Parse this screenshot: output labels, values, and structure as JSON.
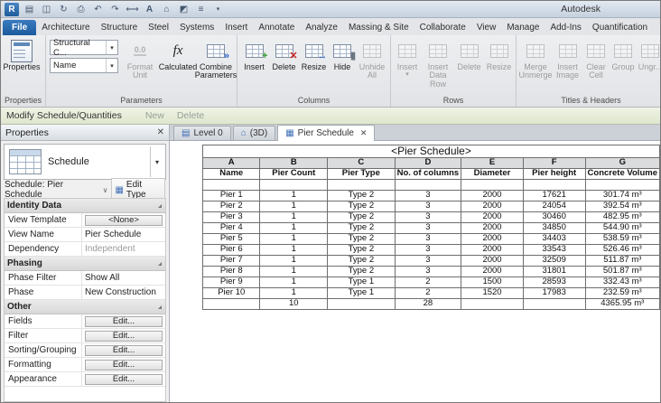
{
  "titlebar": {
    "brand": "Autodesk"
  },
  "ribbon_tabs": {
    "file": "File",
    "items": [
      "Architecture",
      "Structure",
      "Steel",
      "Systems",
      "Insert",
      "Annotate",
      "Analyze",
      "Massing & Site",
      "Collaborate",
      "View",
      "Manage",
      "Add-Ins",
      "Quantification"
    ]
  },
  "ribbon": {
    "properties": {
      "button": "Properties",
      "label": "Properties"
    },
    "parameters": {
      "field1": "Structural C...",
      "field2": "Name",
      "format_unit": "Format Unit",
      "calculated": "Calculated",
      "combine": "Combine Parameters",
      "label": "Parameters"
    },
    "columns": {
      "insert": "Insert",
      "delete": "Delete",
      "resize": "Resize",
      "hide": "Hide",
      "unhide": "Unhide All",
      "label": "Columns"
    },
    "rows": {
      "insert": "Insert",
      "insert_data_row": "Insert Data Row",
      "delete": "Delete",
      "resize": "Resize",
      "label": "Rows"
    },
    "titles": {
      "merge": "Merge Unmerge",
      "image": "Insert Image",
      "clear": "Clear Cell",
      "group": "Group",
      "ungroup": "Ungr...",
      "label": "Titles & Headers"
    }
  },
  "modify_bar": {
    "title": "Modify Schedule/Quantities",
    "new_label": "New",
    "delete_label": "Delete"
  },
  "properties_panel": {
    "header": "Properties",
    "type_selector": "Schedule",
    "instance_label": "Schedule: Pier Schedule",
    "edit_type": "Edit Type",
    "rows": [
      {
        "name": "Identity Data"
      },
      {
        "name": "View Template",
        "value": "<None>"
      },
      {
        "name": "View Name",
        "value": "Pier Schedule"
      },
      {
        "name": "Dependency",
        "value": "Independent"
      },
      {
        "name": "Phasing"
      },
      {
        "name": "Phase Filter",
        "value": "Show All"
      },
      {
        "name": "Phase",
        "value": "New Construction"
      },
      {
        "name": "Other"
      },
      {
        "name": "Fields",
        "value": "Edit..."
      },
      {
        "name": "Filter",
        "value": "Edit..."
      },
      {
        "name": "Sorting/Grouping",
        "value": "Edit..."
      },
      {
        "name": "Formatting",
        "value": "Edit..."
      },
      {
        "name": "Appearance",
        "value": "Edit..."
      }
    ]
  },
  "view_tabs": [
    {
      "label": "Level 0"
    },
    {
      "label": "(3D)"
    },
    {
      "label": "Pier Schedule",
      "close": "✕"
    }
  ],
  "schedule": {
    "title": "<Pier Schedule>",
    "letters": [
      "A",
      "B",
      "C",
      "D",
      "E",
      "F",
      "G"
    ],
    "headers": [
      "Name",
      "Pier Count",
      "Pier Type",
      "No. of columns",
      "Diameter",
      "Pier height",
      "Concrete Volume"
    ],
    "rows": [
      [
        "Pier 1",
        "1",
        "Type 2",
        "3",
        "2000",
        "17621",
        "301.74 m³"
      ],
      [
        "Pier 2",
        "1",
        "Type 2",
        "3",
        "2000",
        "24054",
        "392.54 m³"
      ],
      [
        "Pier 3",
        "1",
        "Type 2",
        "3",
        "2000",
        "30460",
        "482.95 m³"
      ],
      [
        "Pier 4",
        "1",
        "Type 2",
        "3",
        "2000",
        "34850",
        "544.90 m³"
      ],
      [
        "Pier 5",
        "1",
        "Type 2",
        "3",
        "2000",
        "34403",
        "538.59 m³"
      ],
      [
        "Pier 6",
        "1",
        "Type 2",
        "3",
        "2000",
        "33543",
        "526.46 m³"
      ],
      [
        "Pier 7",
        "1",
        "Type 2",
        "3",
        "2000",
        "32509",
        "511.87 m³"
      ],
      [
        "Pier 8",
        "1",
        "Type 2",
        "3",
        "2000",
        "31801",
        "501.87 m³"
      ],
      [
        "Pier 9",
        "1",
        "Type 1",
        "2",
        "1500",
        "28593",
        "332.43 m³"
      ],
      [
        "Pier 10",
        "1",
        "Type 1",
        "2",
        "1520",
        "17983",
        "232.59 m³"
      ]
    ],
    "totals": [
      "",
      "10",
      "",
      "28",
      "",
      "",
      "4365.95 m³"
    ]
  }
}
